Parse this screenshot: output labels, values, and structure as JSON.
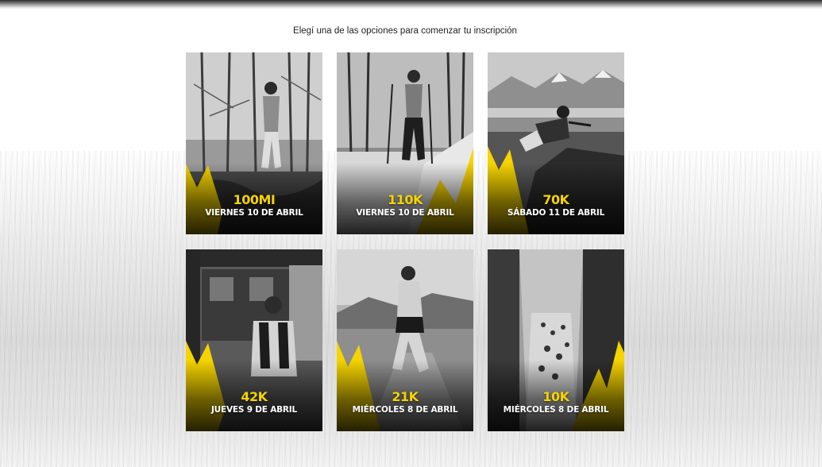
{
  "header": {
    "subtitle": "Elegí una de las opciones para comenzar tu inscripción"
  },
  "colors": {
    "accent_yellow": "#f5d400",
    "text_white": "#ffffff"
  },
  "races": [
    {
      "distance": "100MI",
      "date": "VIERNES 10 DE ABRIL",
      "photo": "runner-forest"
    },
    {
      "distance": "110K",
      "date": "VIERNES 10 DE ABRIL",
      "photo": "runner-poles-forest"
    },
    {
      "distance": "70K",
      "date": "SÁBADO 11 DE ABRIL",
      "photo": "runner-mountains"
    },
    {
      "distance": "42K",
      "date": "JUEVES 9 DE ABRIL",
      "photo": "runner-cabin"
    },
    {
      "distance": "21K",
      "date": "MIÉRCOLES 8 DE ABRIL",
      "photo": "runner-trail"
    },
    {
      "distance": "10K",
      "date": "MIÉRCOLES 8 DE ABRIL",
      "photo": "runners-group-trail"
    }
  ]
}
